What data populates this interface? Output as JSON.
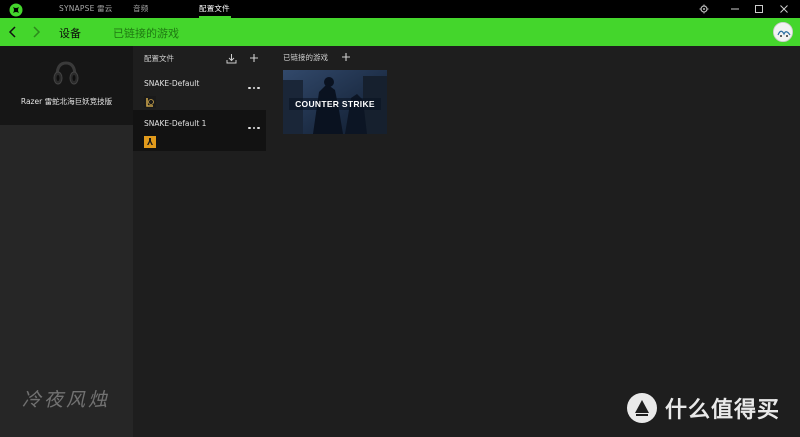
{
  "titlebar": {
    "tabs": [
      {
        "label": "SYNAPSE 雷云"
      },
      {
        "label": "音频"
      },
      {
        "label": "配置文件"
      }
    ],
    "accent": "#44d62c"
  },
  "nav": {
    "title": "设备",
    "subtitle": "已链接的游戏"
  },
  "device": {
    "name": "Razer 雷蛇北海巨妖竞技版"
  },
  "profiles": {
    "heading": "配置文件",
    "items": [
      {
        "name": "SNAKE-Default",
        "game_icon": "league-of-legends-icon"
      },
      {
        "name": "SNAKE-Default 1",
        "game_icon": "counter-strike-icon"
      }
    ]
  },
  "linked_games": {
    "heading": "已链接的游戏",
    "games": [
      {
        "title": "COUNTER STRIKE"
      }
    ]
  },
  "watermarks": {
    "left": "冷夜风烛",
    "right": "什么值得买"
  }
}
